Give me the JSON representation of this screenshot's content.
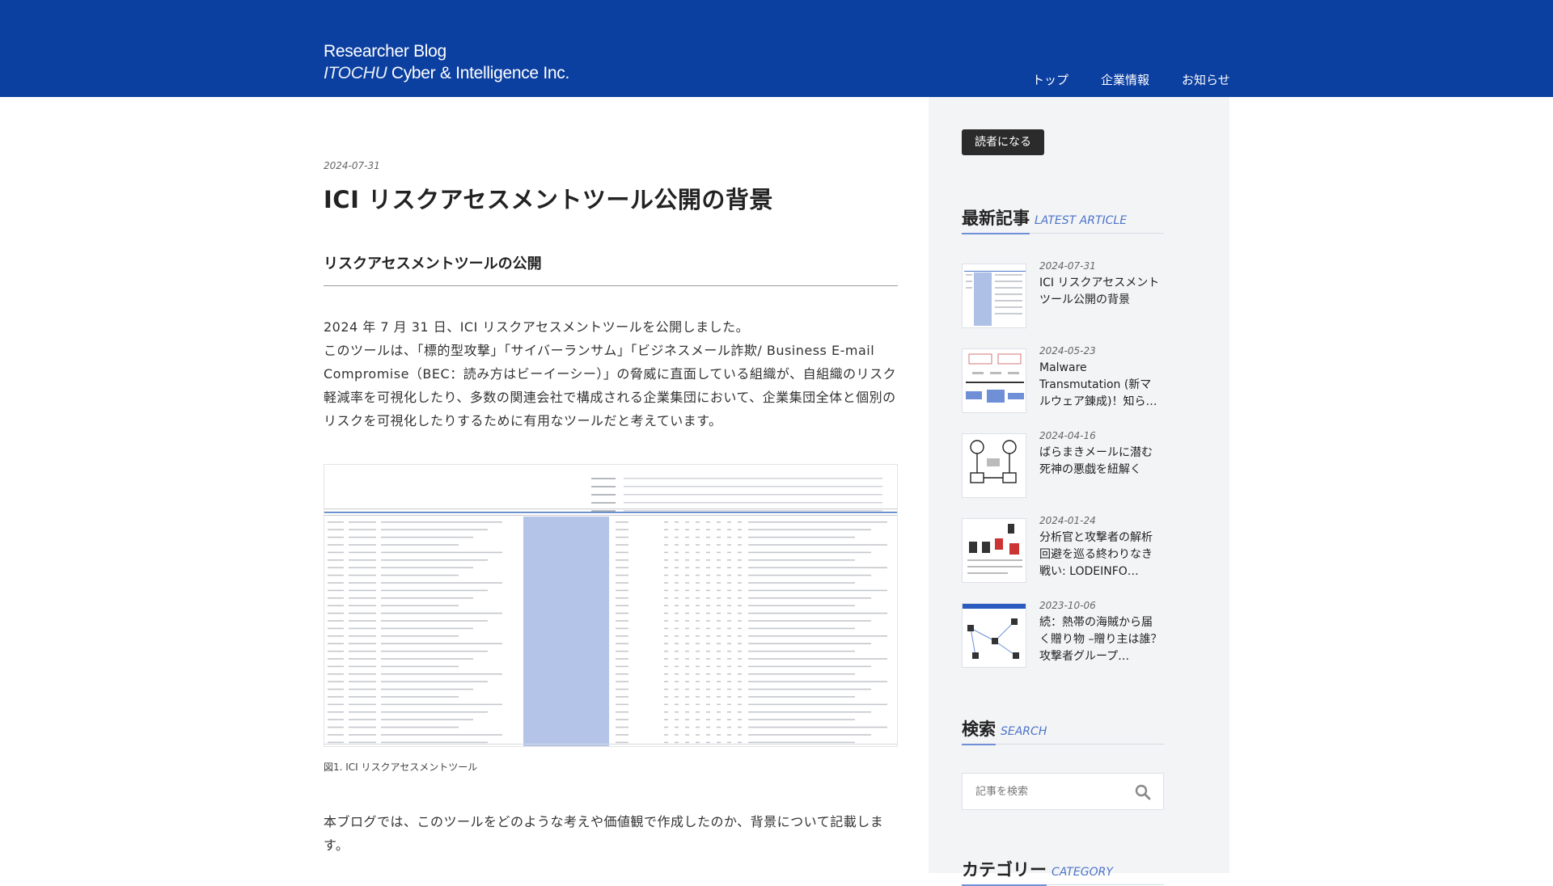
{
  "header": {
    "blog_name": "Researcher Blog",
    "company_italic": "ITOCHU",
    "company_rest": " Cyber & Intelligence Inc.",
    "nav": [
      "トップ",
      "企業情報",
      "お知らせ"
    ]
  },
  "article": {
    "date": "2024-07-31",
    "title": "ICI リスクアセスメントツール公開の背景",
    "section_heading": "リスクアセスメントツールの公開",
    "paragraph1_line1": "2024 年 7 月 31 日、ICI リスクアセスメントツールを公開しました。",
    "paragraph1_line2": "このツールは、「標的型攻撃」「サイバーランサム」「ビジネスメール詐欺/ Business E-mail Compromise（BEC：読み方はビーイーシー）」の脅威に直面している組織が、自組織のリスク軽減率を可視化したり、多数の関連会社で構成される企業集団において、企業集団全体と個別のリスクを可視化したりするために有用なツールだと考えています。",
    "figure_caption": "図1. ICI リスクアセスメントツール",
    "paragraph2": "本ブログでは、このツールをどのような考えや価値観で作成したのか、背景について記載します。"
  },
  "sidebar": {
    "follow_button": "読者になる",
    "latest": {
      "title_jp": "最新記事",
      "title_en": "LATEST ARTICLE"
    },
    "articles": [
      {
        "date": "2024-07-31",
        "title": "ICI リスクアセスメントツール公開の背景"
      },
      {
        "date": "2024-05-23",
        "title": "Malware Transmutation (新マルウェア錬成)！知られざる…"
      },
      {
        "date": "2024-04-16",
        "title": "ばらまきメールに潜む死神の悪戯を紐解く"
      },
      {
        "date": "2024-01-24",
        "title": "分析官と攻撃者の解析回避を巡る終わりなき戦い: LODEINFO…"
      },
      {
        "date": "2023-10-06",
        "title": "続：熱帯の海賊から届く贈り物 –贈り主は誰？攻撃者グループ…"
      }
    ],
    "search": {
      "title_jp": "検索",
      "title_en": "SEARCH",
      "placeholder": "記事を検索"
    },
    "category": {
      "title_jp": "カテゴリー",
      "title_en": "CATEGORY"
    }
  },
  "colors": {
    "header_bg": "#0b3fa0",
    "accent": "#4d74c9",
    "sidebar_bg": "#f3f4f6"
  },
  "icons": {
    "search": "search-icon"
  }
}
